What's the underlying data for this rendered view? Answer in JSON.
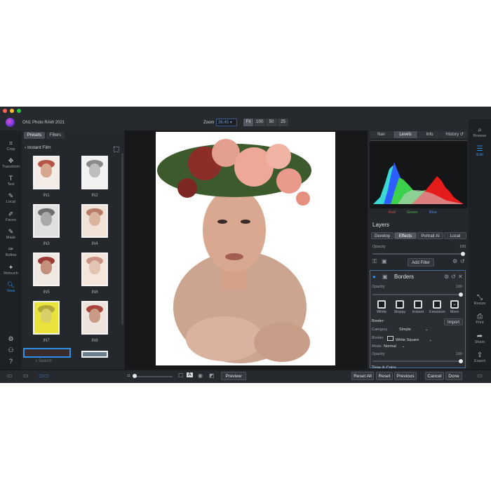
{
  "app": {
    "title": "ON1 Photo RAW 2021",
    "window_dots": [
      "#ff5f57",
      "#febc2e",
      "#28c840"
    ]
  },
  "zoom": {
    "label": "Zoom",
    "value": "36.45",
    "buttons": [
      "Fit",
      "100",
      "50",
      "25"
    ]
  },
  "tools": [
    {
      "label": "Crop",
      "icon": "crop-icon"
    },
    {
      "label": "Transform",
      "icon": "move-icon"
    },
    {
      "label": "Text",
      "icon": "text-icon"
    },
    {
      "label": "Local",
      "icon": "brush-icon"
    },
    {
      "label": "Faces",
      "icon": "face-icon"
    },
    {
      "label": "Mask",
      "icon": "mask-icon"
    },
    {
      "label": "Refine",
      "icon": "refine-icon"
    },
    {
      "label": "Retouch",
      "icon": "retouch-icon"
    },
    {
      "label": "View",
      "icon": "view-icon"
    }
  ],
  "left_panel": {
    "tabs": [
      "Presets",
      "Filters"
    ],
    "breadcrumb": "Instant Film",
    "thumbnails": [
      "IN1",
      "IN2",
      "IN3",
      "IN4",
      "IN5",
      "IN6",
      "IN7",
      "IN8"
    ],
    "search_placeholder": "Search"
  },
  "right_panel": {
    "tabs": [
      "Nav",
      "Levels",
      "Info",
      "History"
    ],
    "histogram_channels": [
      "Red",
      "Green",
      "Blue"
    ],
    "layers_title": "Layers",
    "layer_tabs": [
      "Develop",
      "Effects",
      "Portrait AI",
      "Local"
    ],
    "opacity_label": "Opacity",
    "opacity_value": "100",
    "add_filter": "Add Filter",
    "filter": {
      "name": "Borders",
      "opacity_label": "Opacity",
      "opacity_value": "100",
      "styles": [
        "White",
        "Sloppy",
        "Instant",
        "Emulsion",
        "More"
      ],
      "border_label": "Border:",
      "import_label": "Import",
      "category_label": "Category",
      "category_value": "Simple",
      "border_field_label": "Border",
      "border_value": "White Square",
      "mode_label": "Mode",
      "mode_value": "Normal",
      "opacity2_label": "Opacity",
      "opacity2_value": "100",
      "next_section": "Tone & Color"
    }
  },
  "right_rail": [
    {
      "label": "Browse",
      "icon": "browse-icon"
    },
    {
      "label": "Edit",
      "icon": "edit-icon"
    },
    {
      "label": "Resize",
      "icon": "resize-icon"
    },
    {
      "label": "Print",
      "icon": "print-icon"
    },
    {
      "label": "Share",
      "icon": "share-icon"
    },
    {
      "label": "Export",
      "icon": "export-icon"
    }
  ],
  "bottom": {
    "preview": "Preview",
    "reset_all": "Reset All",
    "reset": "Reset",
    "previous": "Previous",
    "cancel": "Cancel",
    "done": "Done",
    "view_mode_letter": "A"
  },
  "colors": {
    "accent": "#2f8fe6",
    "panel": "#24272b",
    "background": "#1e2124"
  }
}
